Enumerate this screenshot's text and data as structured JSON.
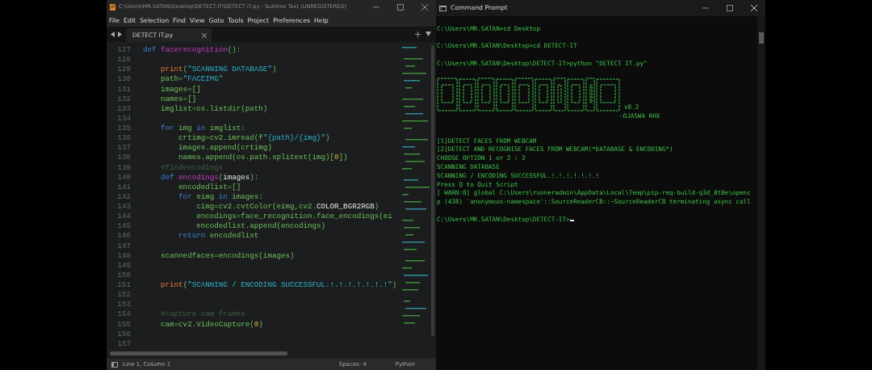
{
  "editor": {
    "title": "C:\\Users\\MR.SATAN\\Desktop\\DETECT-IT\\DETECT IT.py - Sublime Text (UNREGISTERED)",
    "menu": [
      "File",
      "Edit",
      "Selection",
      "Find",
      "View",
      "Goto",
      "Tools",
      "Project",
      "Preferences",
      "Help"
    ],
    "tab": {
      "label": "DETECT IT.py"
    },
    "code_lines": [
      {
        "number": "127",
        "tokens": [
          {
            "kind": "keyword",
            "text": "def "
          },
          {
            "kind": "function",
            "text": "facerecognition"
          },
          {
            "kind": "plain",
            "text": "():"
          }
        ]
      },
      {
        "number": "128"
      },
      {
        "number": "129",
        "tokens": [
          {
            "kind": "builtin",
            "text": "    print"
          },
          {
            "kind": "plain",
            "text": "("
          },
          {
            "kind": "string",
            "text": "\"SCANNING DATABASE\""
          },
          {
            "kind": "plain",
            "text": ")"
          }
        ]
      },
      {
        "number": "130",
        "tokens": [
          {
            "kind": "plain",
            "text": "    path="
          },
          {
            "kind": "string",
            "text": "\"FACEIMG\""
          }
        ]
      },
      {
        "number": "131",
        "tokens": [
          {
            "kind": "plain",
            "text": "    images=[]"
          }
        ]
      },
      {
        "number": "132",
        "tokens": [
          {
            "kind": "plain",
            "text": "    names=[]"
          }
        ]
      },
      {
        "number": "133",
        "tokens": [
          {
            "kind": "plain",
            "text": "    imglist=os.listdir(path)"
          }
        ]
      },
      {
        "number": "134"
      },
      {
        "number": "135",
        "tokens": [
          {
            "kind": "keyword",
            "text": "    for"
          },
          {
            "kind": "plain",
            "text": " img "
          },
          {
            "kind": "keyword",
            "text": "in"
          },
          {
            "kind": "plain",
            "text": " imglist:"
          }
        ]
      },
      {
        "number": "136",
        "tokens": [
          {
            "kind": "plain",
            "text": "        crtimg=cv2.imread(f"
          },
          {
            "kind": "string",
            "text": "\"{path}/{img}\""
          },
          {
            "kind": "plain",
            "text": ")"
          }
        ]
      },
      {
        "number": "137",
        "tokens": [
          {
            "kind": "plain",
            "text": "        images.append(crtimg)"
          }
        ]
      },
      {
        "number": "138",
        "tokens": [
          {
            "kind": "plain",
            "text": "        names.append(os.path.splitext(img)["
          },
          {
            "kind": "number",
            "text": "0"
          },
          {
            "kind": "plain",
            "text": "])"
          }
        ]
      },
      {
        "number": "139",
        "tokens": [
          {
            "kind": "comment",
            "text": "    #findencodings"
          }
        ]
      },
      {
        "number": "140",
        "tokens": [
          {
            "kind": "keyword",
            "text": "    def "
          },
          {
            "kind": "function",
            "text": "encodings"
          },
          {
            "kind": "plain",
            "text": "("
          },
          {
            "kind": "param",
            "text": "images"
          },
          {
            "kind": "plain",
            "text": "):"
          }
        ]
      },
      {
        "number": "141",
        "tokens": [
          {
            "kind": "plain",
            "text": "        encodedlist=[]"
          }
        ]
      },
      {
        "number": "142",
        "tokens": [
          {
            "kind": "keyword",
            "text": "        for"
          },
          {
            "kind": "plain",
            "text": " eimg "
          },
          {
            "kind": "keyword",
            "text": "in"
          },
          {
            "kind": "plain",
            "text": " images:"
          }
        ]
      },
      {
        "number": "143",
        "tokens": [
          {
            "kind": "plain",
            "text": "            cimg=cv2.cvtColor(eimg,cv2."
          },
          {
            "kind": "constant",
            "text": "COLOR_BGR2RGB"
          },
          {
            "kind": "plain",
            "text": ")"
          }
        ]
      },
      {
        "number": "144",
        "tokens": [
          {
            "kind": "plain",
            "text": "            encodings=face_recognition.face_encodings(ei"
          }
        ]
      },
      {
        "number": "145",
        "tokens": [
          {
            "kind": "plain",
            "text": "            encodedlist.append(encodings)"
          }
        ]
      },
      {
        "number": "146",
        "tokens": [
          {
            "kind": "keyword",
            "text": "        return"
          },
          {
            "kind": "plain",
            "text": " encodedlist"
          }
        ]
      },
      {
        "number": "147"
      },
      {
        "number": "148",
        "tokens": [
          {
            "kind": "plain",
            "text": "    scannedfaces=encodings(images)"
          }
        ]
      },
      {
        "number": "149"
      },
      {
        "number": "150"
      },
      {
        "number": "151",
        "tokens": [
          {
            "kind": "builtin",
            "text": "    print"
          },
          {
            "kind": "plain",
            "text": "("
          },
          {
            "kind": "string",
            "text": "\"SCANNING / ENCODING SUCCESSFUL.!.!.!.!.!.!.!\""
          },
          {
            "kind": "plain",
            "text": ")"
          }
        ]
      },
      {
        "number": "152"
      },
      {
        "number": "153"
      },
      {
        "number": "154",
        "tokens": [
          {
            "kind": "comment",
            "text": "    #capture cam frames"
          }
        ]
      },
      {
        "number": "155",
        "tokens": [
          {
            "kind": "plain",
            "text": "    cam=cv2.VideoCapture("
          },
          {
            "kind": "number",
            "text": "0"
          },
          {
            "kind": "plain",
            "text": ")"
          }
        ]
      },
      {
        "number": "156"
      },
      {
        "number": "157"
      }
    ],
    "status_bar": {
      "position": "Line 1, Column 1",
      "indentation": "Spaces: 4",
      "syntax": "Python"
    }
  },
  "terminal": {
    "title": "Command Prompt",
    "lines": [
      {
        "kind": "prompt",
        "text": "C:\\Users\\MR.SATAN>cd Desktop",
        "cursor": false
      },
      {
        "kind": "prompt",
        "text": "C:\\Users\\MR.SATAN\\Desktop>cd DETECT-IT",
        "cursor": false
      },
      {
        "kind": "prompt",
        "text": "C:\\Users\\MR.SATAN\\Desktop\\DETECT-IT>python \"DETECT IT.py\"",
        "cursor": false
      },
      {
        "kind": "banner",
        "version": "v0.2",
        "author": "-OJASWA RHX"
      },
      {
        "kind": "output",
        "text": "[1]DETECT FACES FROM WEBCAM"
      },
      {
        "kind": "output",
        "text": "[2]DETECT AND RECOGNISE FACES FROM WEBCAM(*DATABASE & ENCODING*)"
      },
      {
        "kind": "output",
        "text": "CHOOSE OPTION 1 or 2 : 2"
      },
      {
        "kind": "output",
        "text": "SCANNING DATABASE"
      },
      {
        "kind": "output",
        "text": "SCANNING / ENCODING SUCCESSFUL.!.!.!.!.!.!.!"
      },
      {
        "kind": "output",
        "text": "Press Q to Quit Script"
      },
      {
        "kind": "output",
        "text": "[ WARN:0] global C:\\Users\\runneradmin\\AppData\\Local\\Temp\\pip-req-build-q3d_8t8e\\openc"
      },
      {
        "kind": "output",
        "text": "p (438) `anonymous-namespace'::SourceReaderCB::~SourceReaderCB terminating async call"
      },
      {
        "kind": "prompt",
        "text": "C:\\Users\\MR.SATAN\\Desktop\\DETECT-IT>",
        "cursor": true
      }
    ]
  }
}
